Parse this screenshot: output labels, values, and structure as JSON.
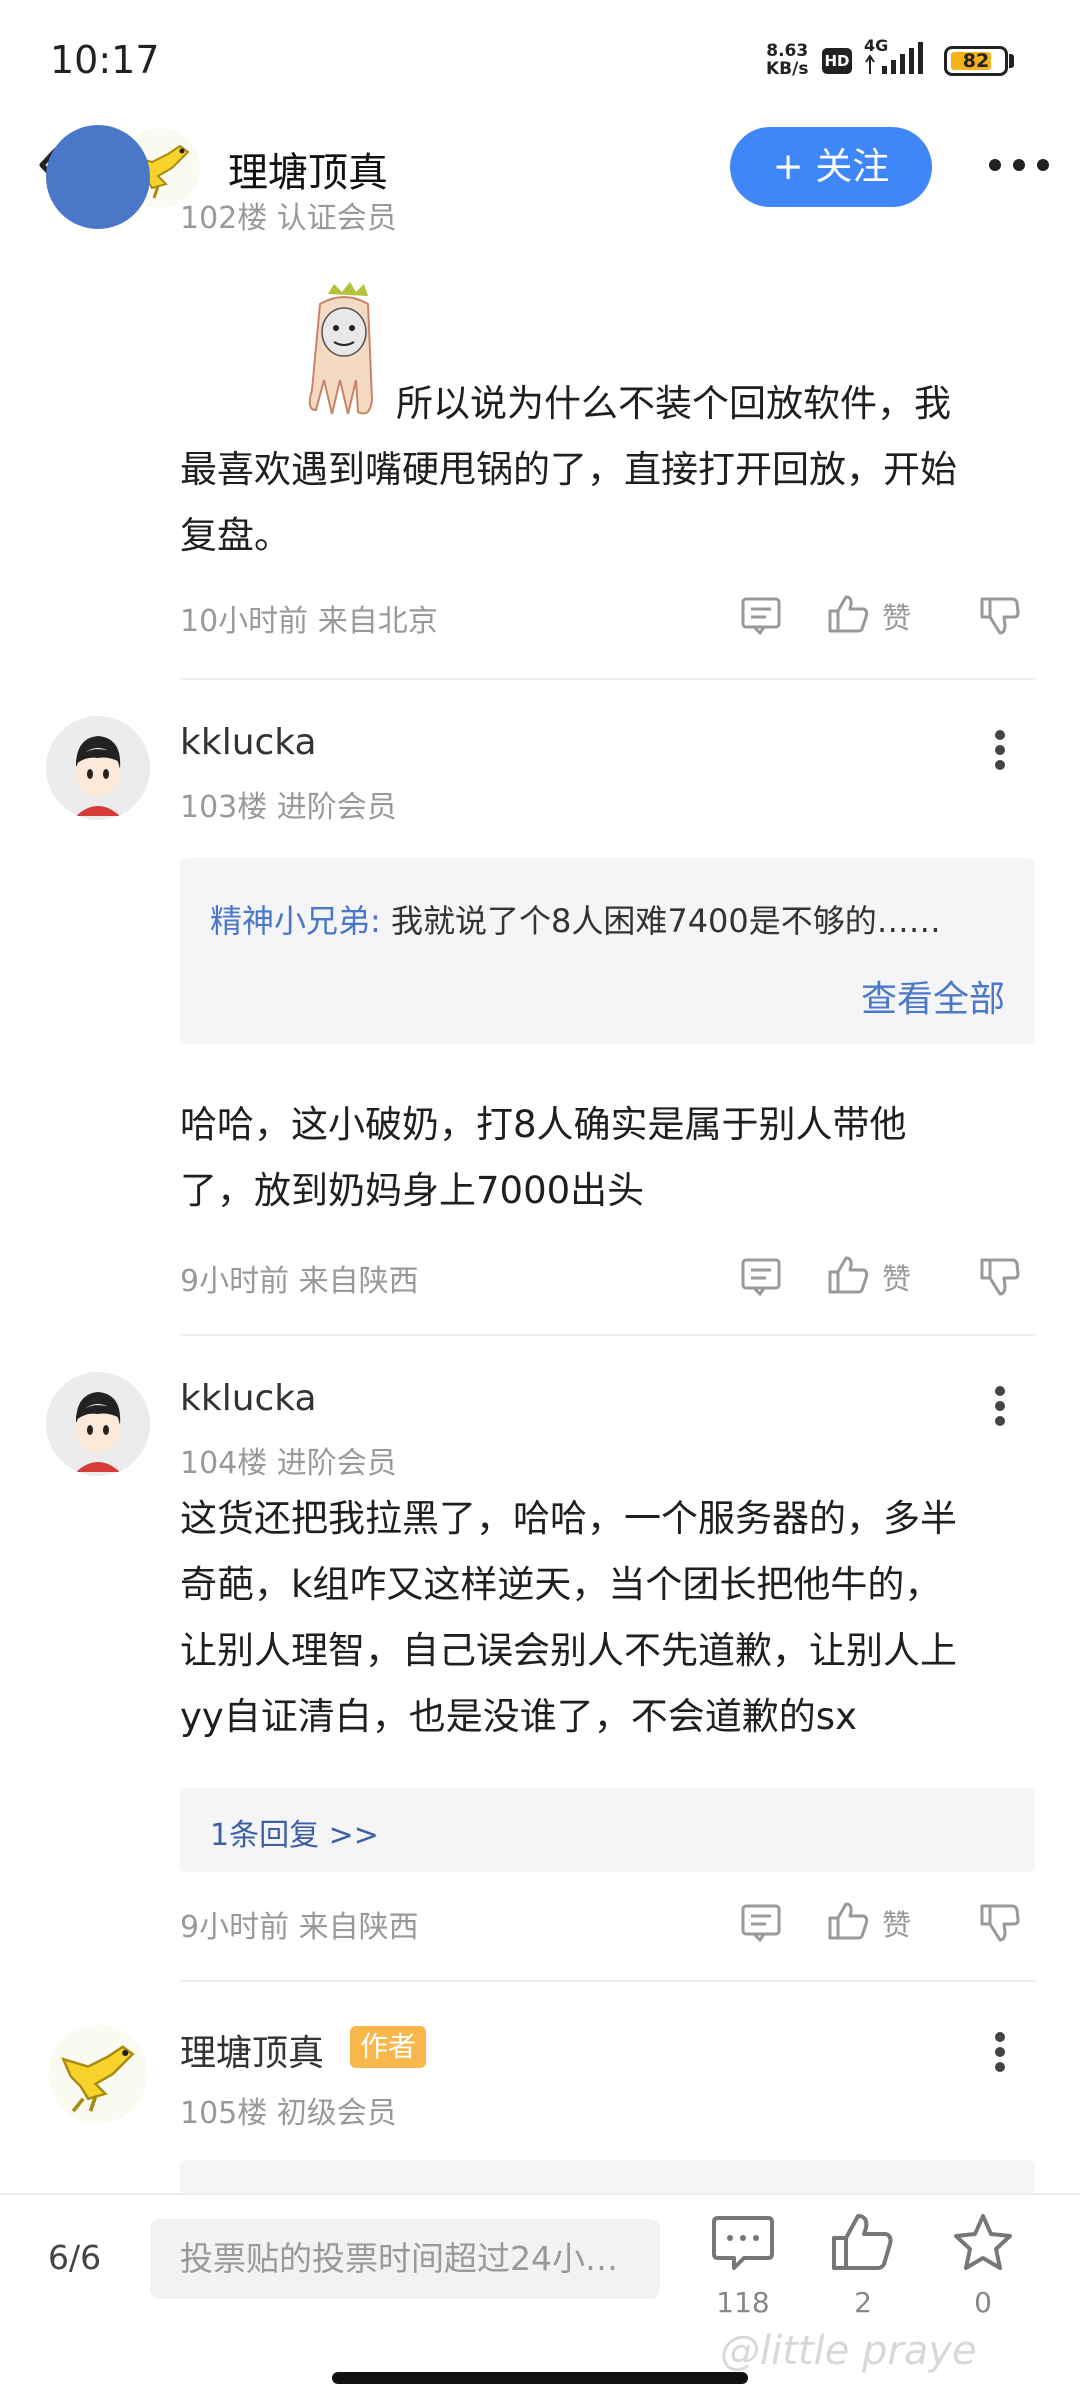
{
  "status": {
    "time": "10:17",
    "net_speed_top": "8.63",
    "net_speed_bottom": "KB/s",
    "hd": "HD",
    "network": "4G",
    "battery": "82"
  },
  "header": {
    "title": "理塘顶真",
    "follow_label": "+ 关注"
  },
  "post_top": {
    "cut_meta": "102楼 认证会员",
    "text_line1": "所以说为什么不装个回放软件，我",
    "text_line2": "最喜欢遇到嘴硬甩锅的了，直接打开回放，开始",
    "text_line3": "复盘。",
    "time_location": "10小时前 来自北京",
    "like_label": "赞"
  },
  "post_103": {
    "username": "kklucka",
    "floor_level": "103楼 进阶会员",
    "quote_author": "精神小兄弟:",
    "quote_text": "我就说了个8人困难7400是不够的……",
    "view_all": "查看全部",
    "text_line1": "哈哈，这小破奶，打8人确实是属于别人带他",
    "text_line2": "了，放到奶妈身上7000出头",
    "time_location": "9小时前 来自陕西",
    "like_label": "赞"
  },
  "post_104": {
    "username": "kklucka",
    "floor_level": "104楼 进阶会员",
    "text_line1": "这货还把我拉黑了，哈哈，一个服务器的，多半",
    "text_line2": "奇葩，k组咋又这样逆天，当个团长把他牛的，",
    "text_line3": "让别人理智，自己误会别人不先道歉，让别人上",
    "text_line4": "yy自证清白，也是没谁了，不会道歉的sx",
    "replies": "1条回复 >>",
    "time_location": "9小时前 来自陕西",
    "like_label": "赞"
  },
  "post_105": {
    "username": "理塘顶真",
    "author_badge": "作者",
    "floor_level": "105楼 初级会员"
  },
  "bottom": {
    "pager": "6/6",
    "input_placeholder": "投票贴的投票时间超过24小…",
    "comment_count": "118",
    "like_count": "2",
    "star_count": "0"
  },
  "watermark": "@little praye",
  "colors": {
    "accent": "#3f86f8",
    "link": "#4a78c8",
    "badge": "#f8b74a"
  }
}
